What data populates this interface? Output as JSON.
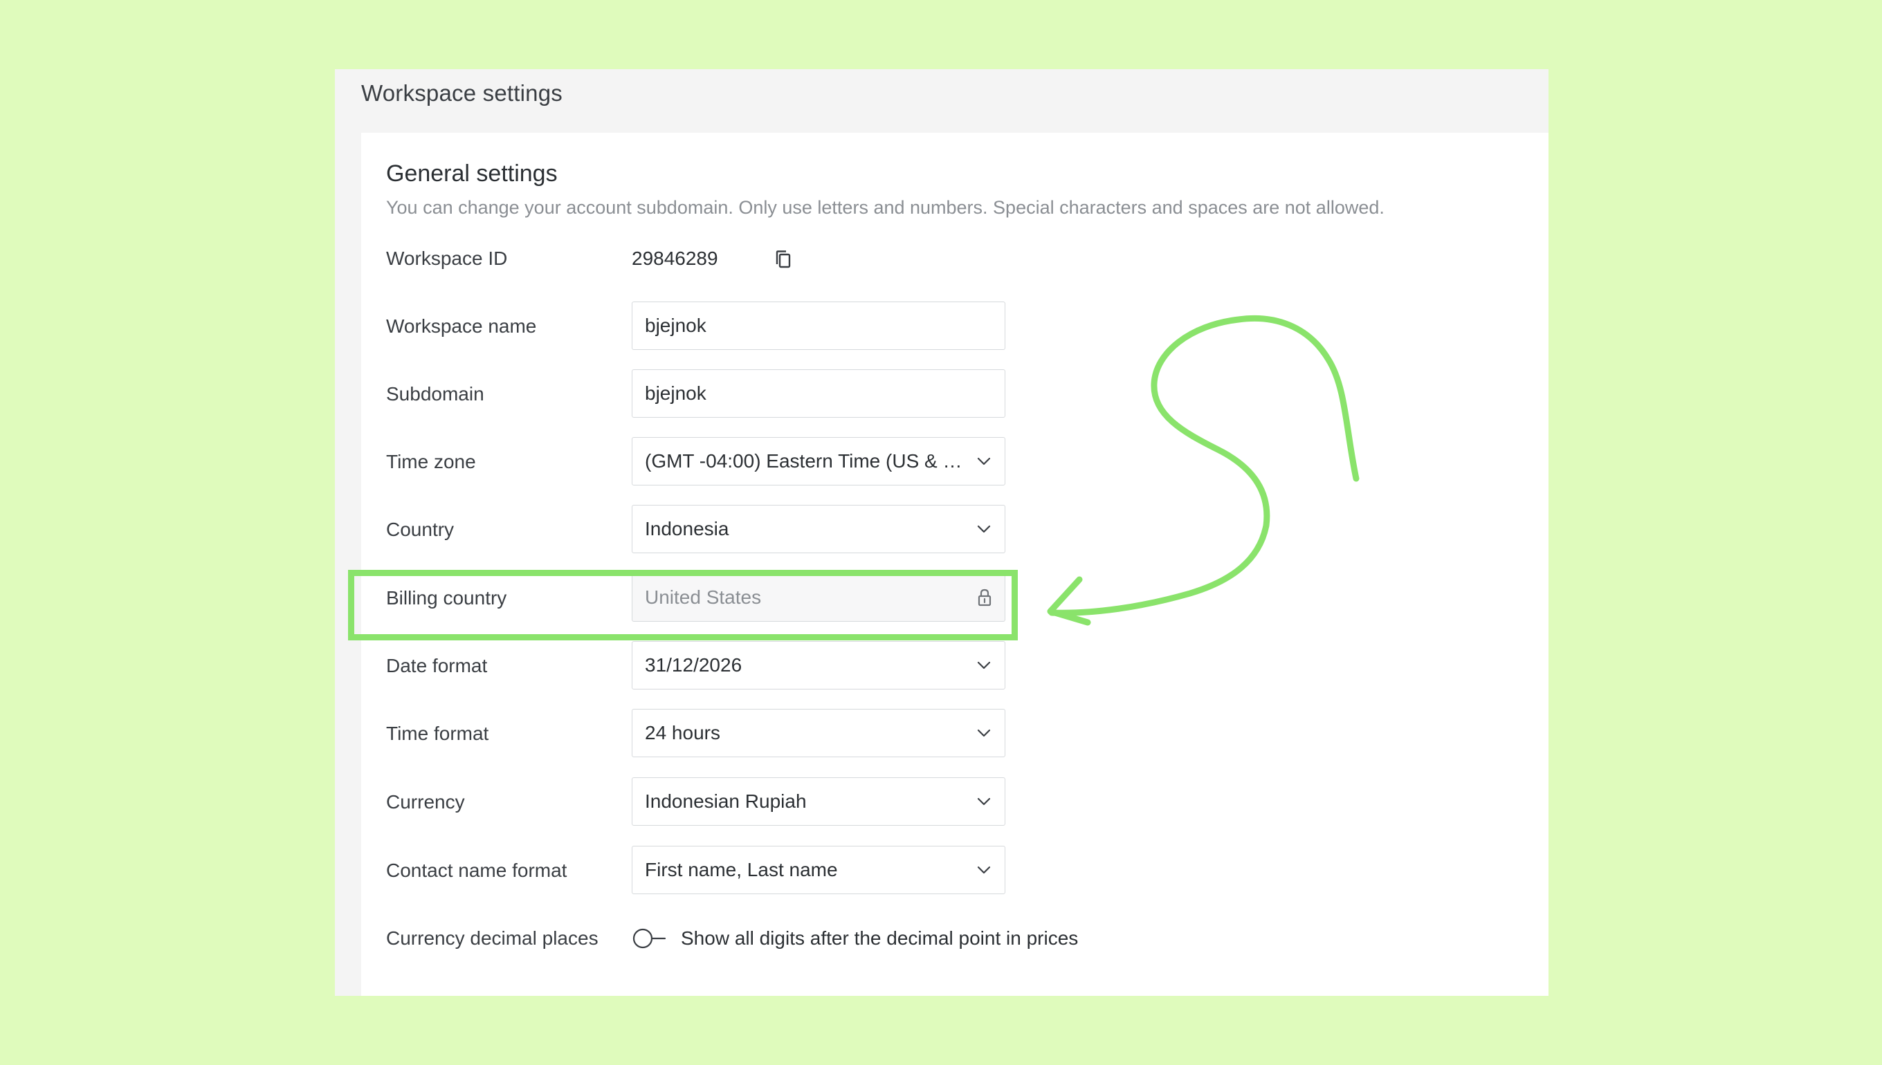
{
  "page": {
    "title": "Workspace settings"
  },
  "section": {
    "title": "General settings",
    "description": "You can change your account subdomain. Only use letters and numbers. Special characters and spaces are not allowed."
  },
  "fields": {
    "workspace_id": {
      "label": "Workspace ID",
      "value": "29846289"
    },
    "workspace_name": {
      "label": "Workspace name",
      "value": "bjejnok"
    },
    "subdomain": {
      "label": "Subdomain",
      "value": "bjejnok"
    },
    "time_zone": {
      "label": "Time zone",
      "value": "(GMT -04:00) Eastern Time (US & Ca..."
    },
    "country": {
      "label": "Country",
      "value": "Indonesia"
    },
    "billing_country": {
      "label": "Billing country",
      "value": "United States",
      "locked": true
    },
    "date_format": {
      "label": "Date format",
      "value": "31/12/2026"
    },
    "time_format": {
      "label": "Time format",
      "value": "24 hours"
    },
    "currency": {
      "label": "Currency",
      "value": "Indonesian Rupiah"
    },
    "contact_name_format": {
      "label": "Contact name format",
      "value": "First name, Last name"
    },
    "currency_decimal_places": {
      "label": "Currency decimal places",
      "toggle_label": "Show all digits after the decimal point in prices",
      "enabled": false
    }
  },
  "icons": {
    "copy": "copy-icon",
    "chevron": "chevron-down-icon",
    "lock": "lock-icon"
  },
  "colors": {
    "background": "#dffbbc",
    "highlight": "#8ae36b"
  }
}
